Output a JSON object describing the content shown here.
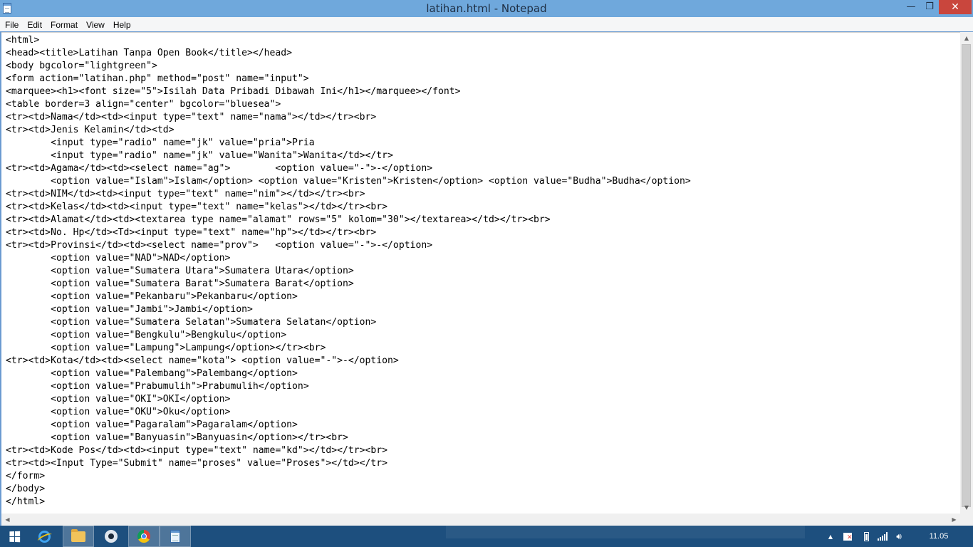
{
  "window": {
    "title": "latihan.html - Notepad",
    "minimize_glyph": "—",
    "maximize_glyph": "❐",
    "close_glyph": "✕"
  },
  "menu": {
    "file": "File",
    "edit": "Edit",
    "format": "Format",
    "view": "View",
    "help": "Help"
  },
  "editor": {
    "content": "<html>\n<head><title>Latihan Tanpa Open Book</title></head>\n<body bgcolor=\"lightgreen\">\n<form action=\"latihan.php\" method=\"post\" name=\"input\">\n<marquee><h1><font size=\"5\">Isilah Data Pribadi Dibawah Ini</h1></marquee></font>\n<table border=3 align=\"center\" bgcolor=\"bluesea\">\n<tr><td>Nama</td><td><input type=\"text\" name=\"nama\"></td></tr><br>\n<tr><td>Jenis Kelamin</td><td>\n\t<input type=\"radio\" name=\"jk\" value=\"pria\">Pria\n\t<input type=\"radio\" name=\"jk\" value=\"Wanita\">Wanita</td></tr>\n<tr><td>Agama</td><td><select name=\"ag\">\t<option value=\"-\">-</option>\n\t<option value=\"Islam\">Islam</option> <option value=\"Kristen\">Kristen</option> <option value=\"Budha\">Budha</option>\n<tr><td>NIM</td><td><input type=\"text\" name=\"nim\"></td></tr><br>\n<tr><td>Kelas</td><td><input type=\"text\" name=\"kelas\"></td></tr><br>\n<tr><td>Alamat</td><td><textarea type name=\"alamat\" rows=\"5\" kolom=\"30\"></textarea></td></tr><br>\n<tr><td>No. Hp</td><Td><input type=\"text\" name=\"hp\"></td></tr><br>\n<tr><td>Provinsi</td><td><select name=\"prov\">   <option value=\"-\">-</option>\n\t<option value=\"NAD\">NAD</option>\n\t<option value=\"Sumatera Utara\">Sumatera Utara</option>\n\t<option value=\"Sumatera Barat\">Sumatera Barat</option>\n\t<option value=\"Pekanbaru\">Pekanbaru</option>\n\t<option value=\"Jambi\">Jambi</option>\n\t<option value=\"Sumatera Selatan\">Sumatera Selatan</option>\n\t<option value=\"Bengkulu\">Bengkulu</option>\n\t<option value=\"Lampung\">Lampung</option></tr><br>\n<tr><td>Kota</td><td><select name=\"kota\"> <option value=\"-\">-</option>\n\t<option value=\"Palembang\">Palembang</option>\n\t<option value=\"Prabumulih\">Prabumulih</option>\n\t<option value=\"OKI\">OKI</option>\n\t<option value=\"OKU\">Oku</option>\n\t<option value=\"Pagaralam\">Pagaralam</option>\n\t<option value=\"Banyuasin\">Banyuasin</option></tr><br>\n<tr><td>Kode Pos</td><td><input type=\"text\" name=\"kd\"></td></tr><br>\n<tr><td><Input Type=\"Submit\" name=\"proses\" value=\"Proses\"></td></tr>\n</form>\n</body>\n</html>"
  },
  "taskbar": {
    "clock": "11.05"
  },
  "colors": {
    "titlebar": "#6fa8dc",
    "close_button": "#c9463d",
    "taskbar": "#1d4f7e"
  }
}
